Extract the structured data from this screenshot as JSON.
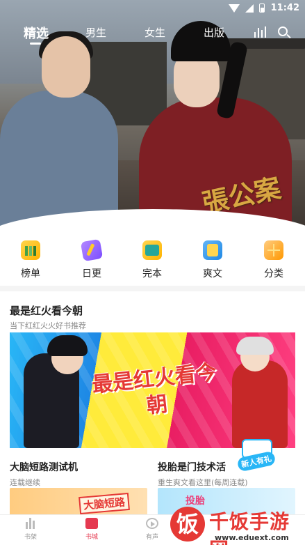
{
  "status_bar": {
    "time": "11:42"
  },
  "hero": {
    "watermark": "張公案"
  },
  "tabs": [
    {
      "label": "精选"
    },
    {
      "label": "男生"
    },
    {
      "label": "女生"
    },
    {
      "label": "出版"
    }
  ],
  "categories": [
    {
      "label": "榜单",
      "icon": "rank-chart-icon"
    },
    {
      "label": "日更",
      "icon": "pen-icon"
    },
    {
      "label": "完本",
      "icon": "book-icon"
    },
    {
      "label": "爽文",
      "icon": "open-book-icon"
    },
    {
      "label": "分类",
      "icon": "grid-icon"
    }
  ],
  "section": {
    "title": "最是红火看今朝",
    "subtitle": "当下红红火火好书推荐",
    "banner_text": "最是红火看今朝"
  },
  "books": [
    {
      "title": "大脑短路测试机",
      "subtitle": "连载继续",
      "thumb_text": "大脑短路"
    },
    {
      "title": "投胎是门技术活",
      "subtitle": "重生爽文看这里(每周连载)",
      "thumb_text": "投胎"
    }
  ],
  "newbie_badge": "新人有礼",
  "bottom_nav": [
    {
      "label": "书架"
    },
    {
      "label": "书城"
    },
    {
      "label": "有声"
    }
  ],
  "watermark": {
    "logo": "饭",
    "name": "千饭手游网",
    "url": "www.eduext.com"
  }
}
